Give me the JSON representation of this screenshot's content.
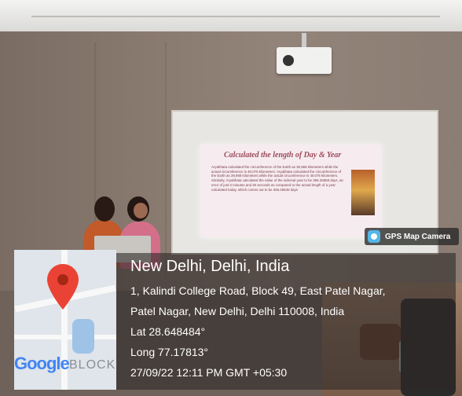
{
  "slide": {
    "title": "Calculated the length of Day & Year",
    "text": "Aryabhata calculated the circumference of the Earth as 39,968 kilometers while the actual circumference is 40,075 kilometers. Aryabhata calculated the circumference of the Earth as 39,968 kilometers while the actual circumference is 40,075 kilometers. Similarly, Aryabhata calculated the value of the sidereal year to be 365.25858 days, an error of just 3 minutes and 20 seconds as compared to the actual length of a year calculated today, which comes out to be 365.25636 days"
  },
  "overlay": {
    "badge_label": "GPS Map Camera",
    "location_title": "New Delhi, Delhi, India",
    "address_line1": "1, Kalindi College Road, Block 49, East Patel Nagar,",
    "address_line2": "Patel Nagar, New Delhi, Delhi 110008, India",
    "latitude": "Lat 28.648484°",
    "longitude": "Long 77.17813°",
    "timestamp": "27/09/22 12:11 PM GMT +05:30"
  },
  "map": {
    "logo_text": "Google",
    "area_label": "BLOCK"
  },
  "colors": {
    "pin": "#ea4335",
    "badge_icon": "#55b6e8"
  }
}
